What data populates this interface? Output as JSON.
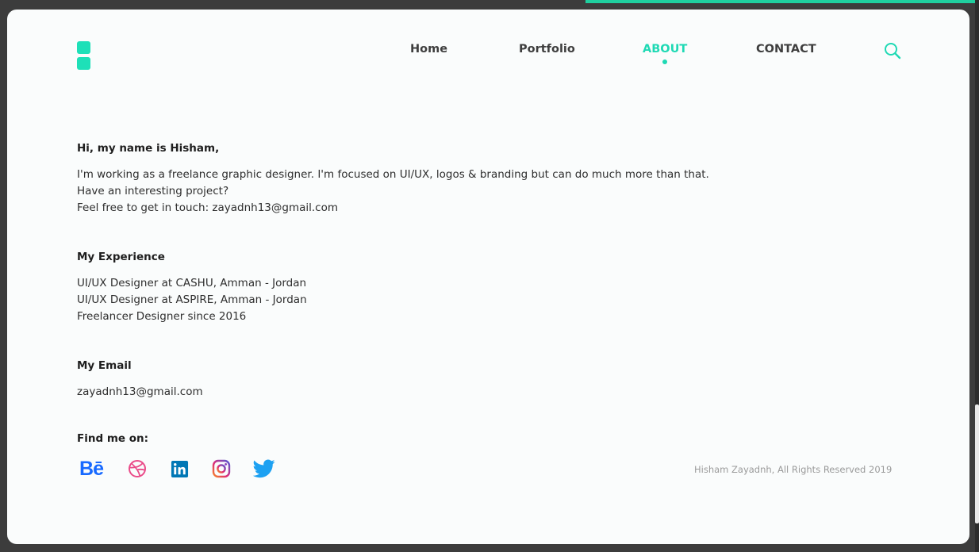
{
  "nav": {
    "home": "Home",
    "portfolio": "Portfolio",
    "about": "ABOUT",
    "contact": "CONTACT"
  },
  "intro": {
    "heading": "Hi, my name is Hisham,",
    "lines": [
      "I'm working as a freelance graphic designer. I'm focused on UI/UX, logos & branding but can do much more than that.",
      "Have an interesting project?",
      "Feel free to get in touch: zayadnh13@gmail.com"
    ]
  },
  "experience": {
    "heading": "My Experience",
    "items": [
      "UI/UX Designer at CASHU, Amman - Jordan",
      "UI/UX Designer at ASPIRE, Amman - Jordan",
      "Freelancer Designer since 2016"
    ]
  },
  "email": {
    "heading": "My Email",
    "value": "zayadnh13@gmail.com"
  },
  "social": {
    "heading": "Find me on:",
    "icons": [
      "behance-icon",
      "dribbble-icon",
      "linkedin-icon",
      "instagram-icon",
      "twitter-icon"
    ],
    "behance_glyph": "Bē"
  },
  "footer": {
    "copyright": "Hisham Zayadnh, All Rights Reserved 2019"
  },
  "colors": {
    "accent": "#1ed9b4",
    "behance": "#1769ff",
    "dribbble": "#ea4c89",
    "linkedin": "#0077b5",
    "twitter": "#1da1f2"
  }
}
